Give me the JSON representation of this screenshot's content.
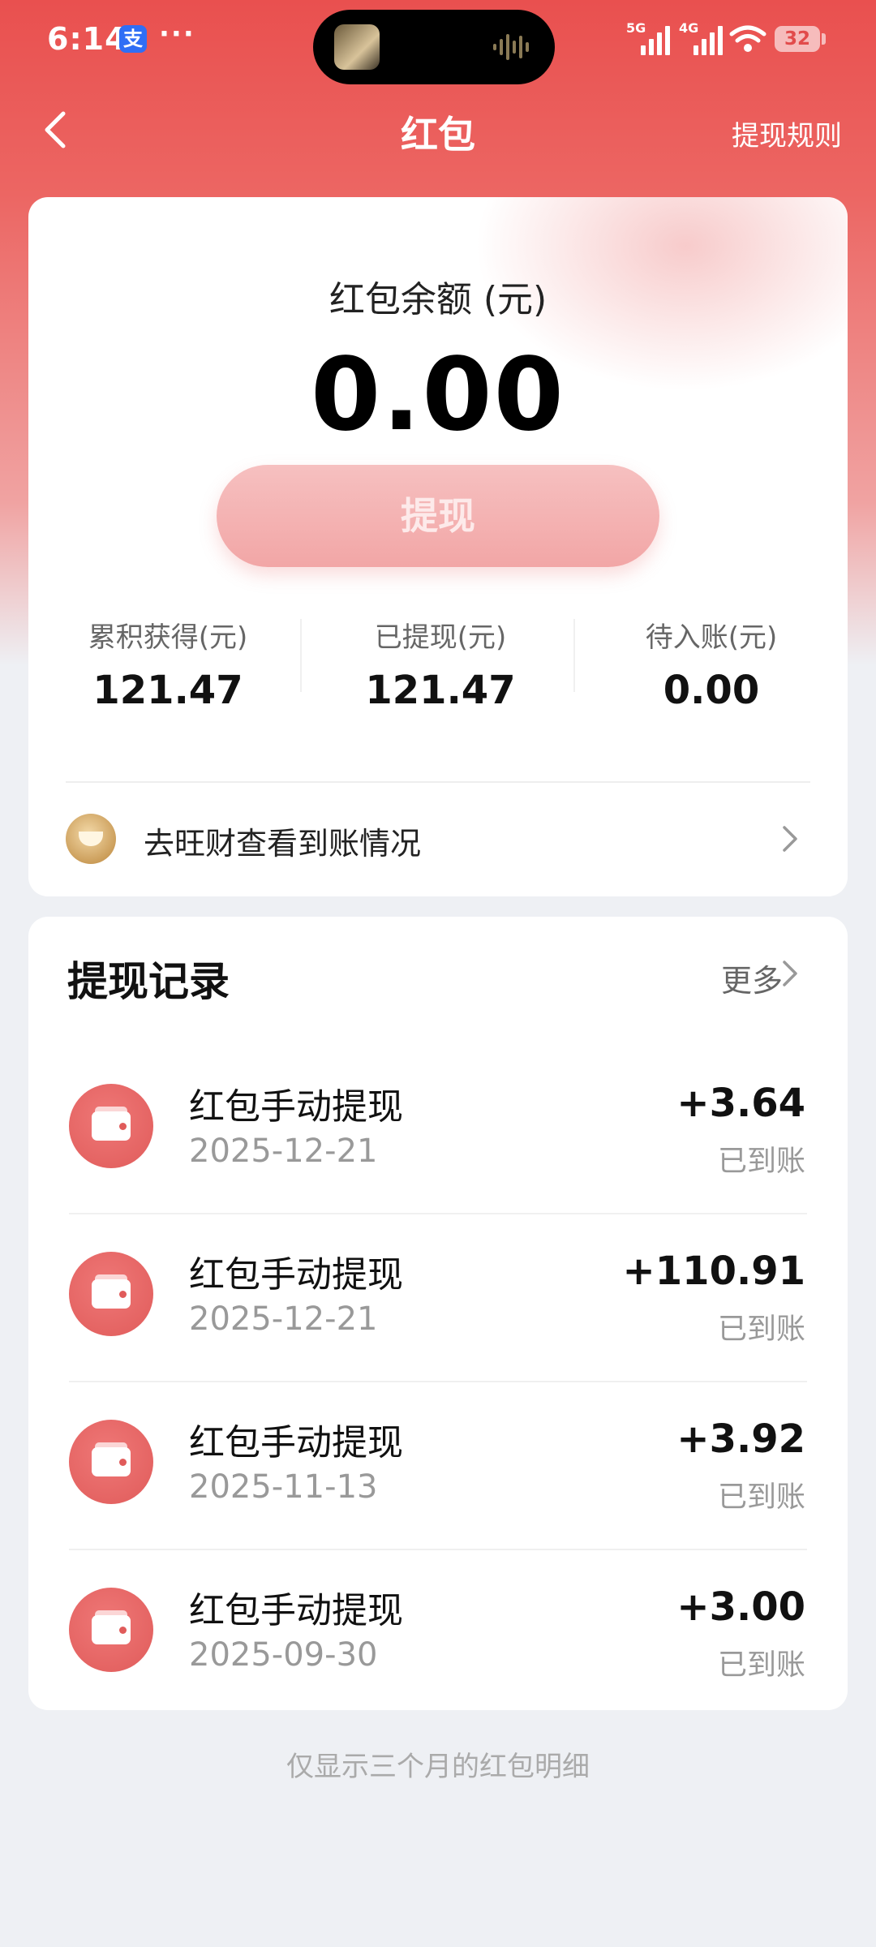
{
  "status_bar": {
    "time": "6:14",
    "alipay_glyph": "支",
    "more": "···",
    "network_5g": "5G",
    "network_4g": "4G",
    "battery": "32"
  },
  "nav": {
    "title": "红包",
    "rules_link": "提现规则"
  },
  "balance": {
    "label": "红包余额 (元)",
    "value": "0.00",
    "withdraw_button": "提现",
    "stats": [
      {
        "label": "累积获得(元)",
        "value": "121.47"
      },
      {
        "label": "已提现(元)",
        "value": "121.47"
      },
      {
        "label": "待入账(元)",
        "value": "0.00"
      }
    ],
    "wangcai_link": "去旺财查看到账情况"
  },
  "records": {
    "title": "提现记录",
    "more": "更多",
    "items": [
      {
        "title": "红包手动提现",
        "date": "2025-12-21",
        "amount": "+3.64",
        "status": "已到账"
      },
      {
        "title": "红包手动提现",
        "date": "2025-12-21",
        "amount": "+110.91",
        "status": "已到账"
      },
      {
        "title": "红包手动提现",
        "date": "2025-11-13",
        "amount": "+3.92",
        "status": "已到账"
      },
      {
        "title": "红包手动提现",
        "date": "2025-09-30",
        "amount": "+3.00",
        "status": "已到账"
      }
    ]
  },
  "footer_note": "仅显示三个月的红包明细",
  "colors": {
    "brand_red": "#e9504f",
    "icon_red": "#e05b5a",
    "button_pink": "#f2a6a6"
  }
}
